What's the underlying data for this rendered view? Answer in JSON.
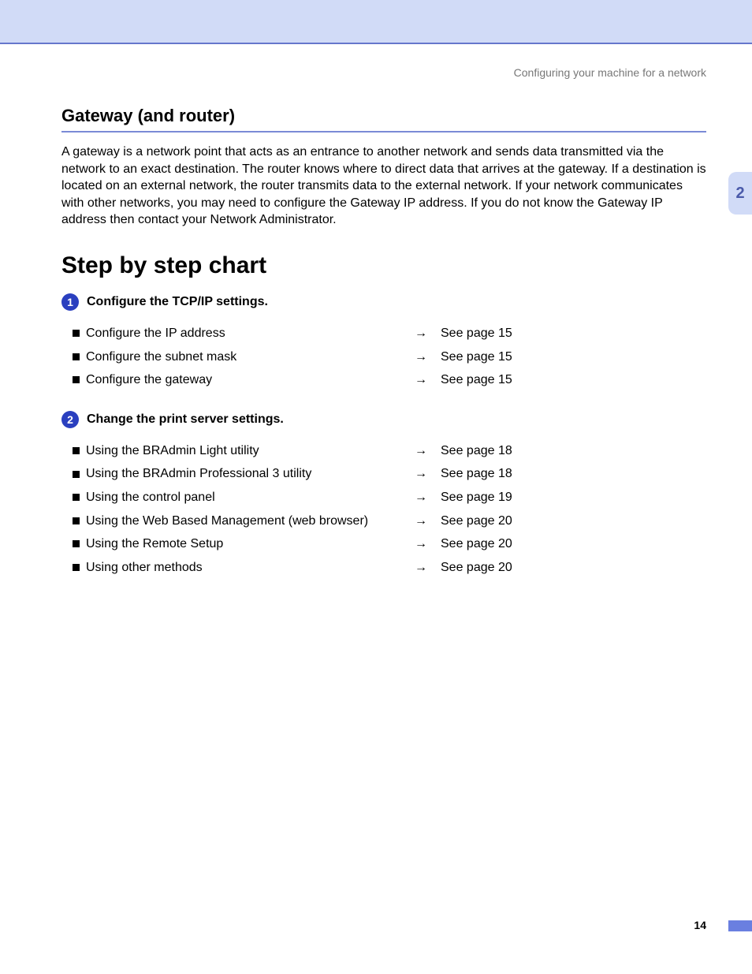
{
  "header": {
    "right": "Configuring your machine for a network"
  },
  "side_tab": "2",
  "section": {
    "title": "Gateway (and router)",
    "body": "A gateway is a network point that acts as an entrance to another network and sends data transmitted via the network to an exact destination. The router knows where to direct data that arrives at the gateway. If a destination is located on an external network, the router transmits data to the external network. If your network communicates with other networks, you may need to configure the Gateway IP address. If you do not know the Gateway IP address then contact your Network Administrator."
  },
  "chart": {
    "title": "Step by step chart",
    "steps": [
      {
        "num": "1",
        "label": "Configure the TCP/IP settings.",
        "rows": [
          {
            "desc": "Configure the IP address",
            "arrow": "→",
            "ref": "See page 15"
          },
          {
            "desc": "Configure the subnet mask",
            "arrow": "→",
            "ref": "See page 15"
          },
          {
            "desc": "Configure the gateway",
            "arrow": "→",
            "ref": "See page 15"
          }
        ]
      },
      {
        "num": "2",
        "label": "Change the print server settings.",
        "rows": [
          {
            "desc": "Using the BRAdmin Light utility",
            "arrow": "→",
            "ref": "See page 18"
          },
          {
            "desc": "Using the BRAdmin Professional 3 utility",
            "arrow": "→",
            "ref": "See page 18"
          },
          {
            "desc": "Using the control panel",
            "arrow": "→",
            "ref": "See page 19"
          },
          {
            "desc": "Using the Web Based Management (web browser)",
            "arrow": "→",
            "ref": "See page 20"
          },
          {
            "desc": "Using the Remote Setup",
            "arrow": "→",
            "ref": "See page 20"
          },
          {
            "desc": "Using other methods",
            "arrow": "→",
            "ref": "See page 20"
          }
        ]
      }
    ]
  },
  "page_number": "14"
}
